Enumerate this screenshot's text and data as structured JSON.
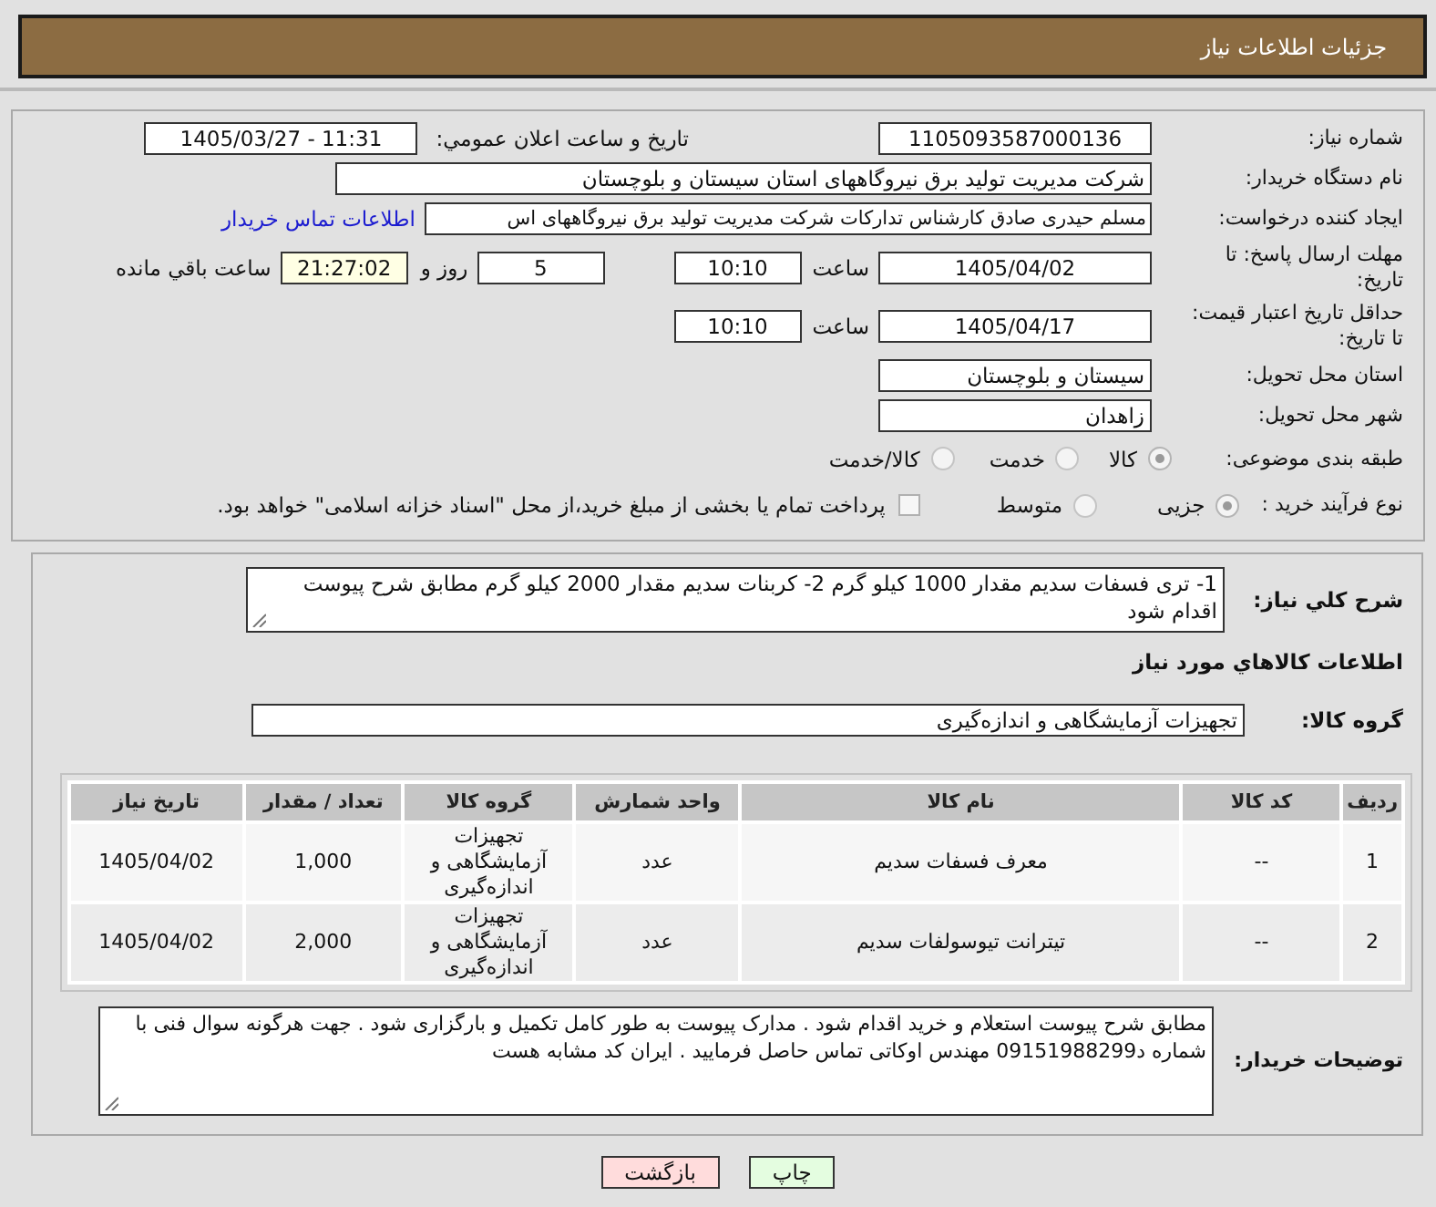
{
  "header": {
    "title": "جزئیات اطلاعات نیاز"
  },
  "details": {
    "need_number": {
      "label": "شماره نیاز:",
      "value": "1105093587000136"
    },
    "announcement": {
      "label": "تاریخ و ساعت اعلان عمومي:",
      "value": "1405/03/27 - 11:31"
    },
    "buyer_org": {
      "label": "نام دستگاه خریدار:",
      "value": "شرکت مدیریت تولید برق نیروگاههای استان سیستان و بلوچستان"
    },
    "requester": {
      "label": "ایجاد کننده درخواست:",
      "value": "مسلم حیدری صادق کارشناس تدارکات شرکت مدیریت تولید برق نیروگاههای اس",
      "contact_link": "اطلاعات تماس خریدار"
    },
    "response_deadline": {
      "label": "مهلت ارسال پاسخ: تا تاریخ:",
      "date": "1405/04/02",
      "time_label": "ساعت",
      "time": "10:10",
      "days": "5",
      "days_label": "روز و",
      "remaining": "21:27:02",
      "remaining_label": "ساعت باقي مانده"
    },
    "price_validity": {
      "label": "حداقل تاریخ اعتبار قیمت: تا تاریخ:",
      "date": "1405/04/17",
      "time_label": "ساعت",
      "time": "10:10"
    },
    "delivery_province": {
      "label": "استان محل تحویل:",
      "value": "سیستان و بلوچستان"
    },
    "delivery_city": {
      "label": "شهر محل تحویل:",
      "value": "زاهدان"
    },
    "subject_category": {
      "label": "طبقه بندی موضوعی:",
      "options": [
        {
          "label": "کالا",
          "selected": true
        },
        {
          "label": "خدمت",
          "selected": false
        },
        {
          "label": "کالا/خدمت",
          "selected": false
        }
      ]
    },
    "purchase_type": {
      "label": "نوع فرآیند خرید :",
      "options": [
        {
          "label": "جزیی",
          "selected": true
        },
        {
          "label": "متوسط",
          "selected": false
        }
      ],
      "treasury_payment": {
        "label": "پرداخت تمام یا بخشی از مبلغ خرید،از محل \"اسناد خزانه اسلامی\" خواهد بود.",
        "checked": false
      }
    }
  },
  "needs": {
    "summary": {
      "label": "شرح کلي نیاز:",
      "value": "1- تری فسفات سدیم مقدار 1000 کیلو گرم 2- کربنات سدیم  مقدار  2000 کیلو گرم   مطابق شرح پیوست اقدام شود"
    },
    "goods_title": "اطلاعات کالاهاي مورد نیاز",
    "goods_group": {
      "label": "گروه کالا:",
      "value": "تجهیزات آزمایشگاهی و اندازه‌گیری"
    },
    "table": {
      "columns": [
        "ردیف",
        "کد کالا",
        "نام کالا",
        "واحد شمارش",
        "گروه کالا",
        "تعداد / مقدار",
        "تاریخ نیاز"
      ],
      "rows": [
        [
          "1",
          "--",
          "معرف فسفات سدیم",
          "عدد",
          "تجهیزات آزمایشگاهی و اندازه‌گیری",
          "1,000",
          "1405/04/02"
        ],
        [
          "2",
          "--",
          "تیترانت تیوسولفات سدیم",
          "عدد",
          "تجهیزات آزمایشگاهی و اندازه‌گیری",
          "2,000",
          "1405/04/02"
        ]
      ]
    },
    "buyer_notes": {
      "label": "توضیحات خریدار:",
      "value": "مطابق شرح پیوست استعلام و خرید اقدام شود . مدارک پیوست به طور کامل تکمیل و بارگزاری شود . جهت هرگونه سوال فنی با شماره د09151988299 مهندس اوکاتی تماس حاصل فرمایید . ایران کد مشابه هست"
    }
  },
  "buttons": [
    {
      "kind": "print",
      "label": "چاپ"
    },
    {
      "kind": "back",
      "label": "بازگشت"
    }
  ]
}
